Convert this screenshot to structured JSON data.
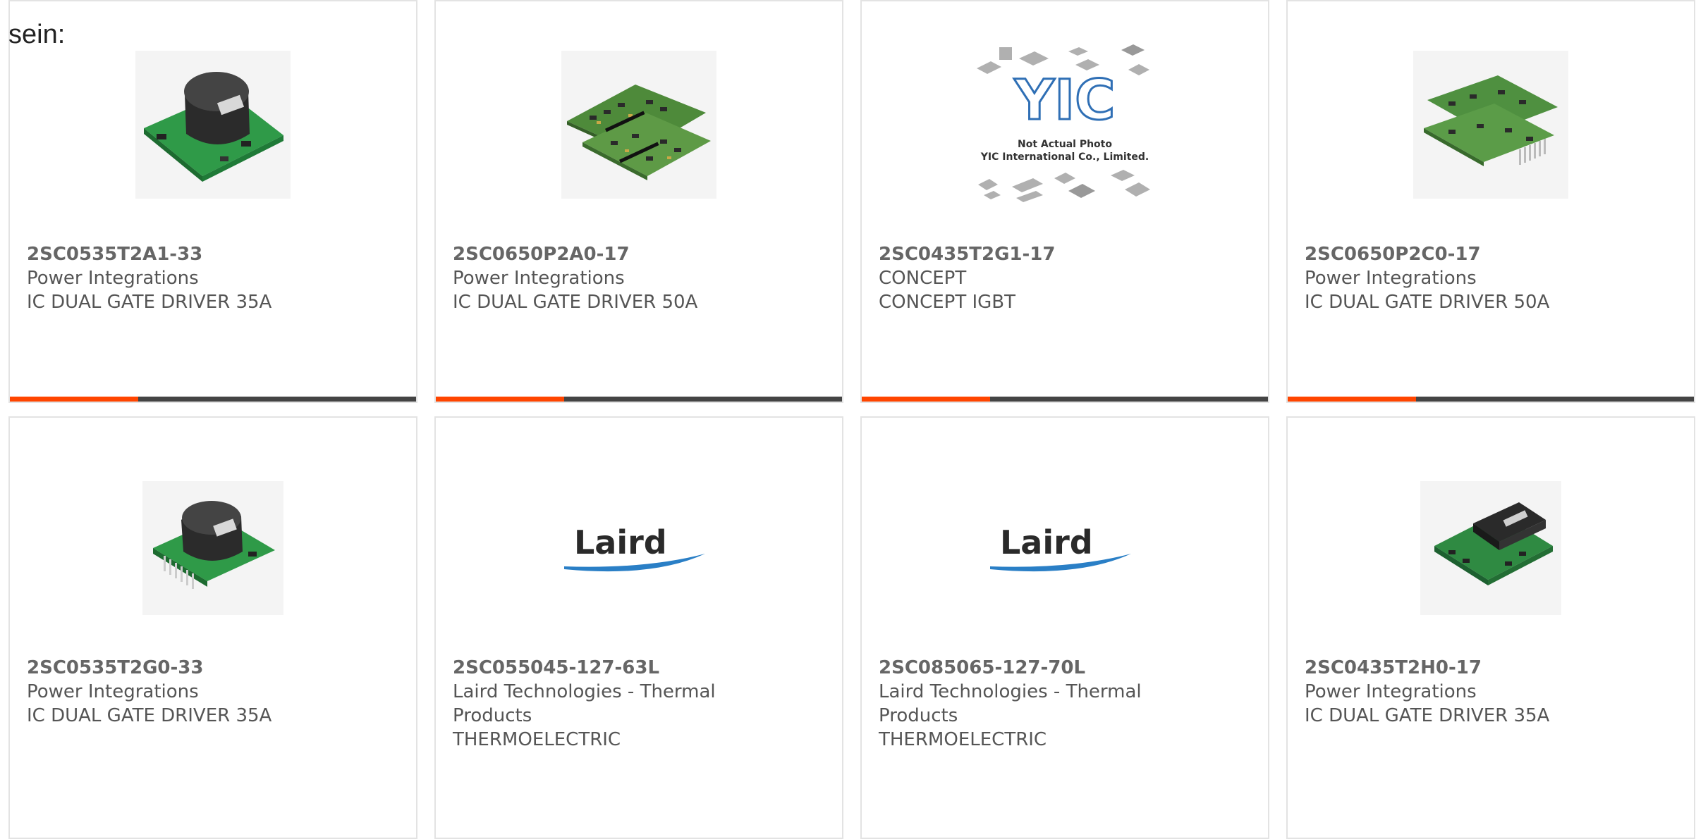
{
  "intro_text": "sein:",
  "brand_accent": "#ff4500",
  "bar_color": "#444444",
  "products": [
    {
      "part_number": "2SC0535T2A1-33",
      "manufacturer": "Power Integrations",
      "description": "IC DUAL GATE DRIVER 35A",
      "image": "driver-board-round-transformer"
    },
    {
      "part_number": "2SC0650P2A0-17",
      "manufacturer": "Power Integrations",
      "description": "IC DUAL GATE DRIVER 50A",
      "image": "dual-driver-board"
    },
    {
      "part_number": "2SC0435T2G1-17",
      "manufacturer": "CONCEPT",
      "description": "CONCEPT IGBT",
      "image": "yic-placeholder",
      "image_text": {
        "logo": "YIC",
        "line1": "Not Actual Photo",
        "line2": "YIC International Co., Limited."
      }
    },
    {
      "part_number": "2SC0650P2C0-17",
      "manufacturer": "Power Integrations",
      "description": "IC DUAL GATE DRIVER 50A",
      "image": "dual-driver-board-pins"
    },
    {
      "part_number": "2SC0535T2G0-33",
      "manufacturer": "Power Integrations",
      "description": "IC DUAL GATE DRIVER 35A",
      "image": "driver-board-round-transformer-pins"
    },
    {
      "part_number": "2SC055045-127-63L",
      "manufacturer_line1": "Laird Technologies - Thermal",
      "manufacturer_line2": "Products",
      "description": "THERMOELECTRIC",
      "image": "laird-logo",
      "logo_text": "Laird"
    },
    {
      "part_number": "2SC085065-127-70L",
      "manufacturer_line1": "Laird Technologies - Thermal",
      "manufacturer_line2": "Products",
      "description": "THERMOELECTRIC",
      "image": "laird-logo",
      "logo_text": "Laird"
    },
    {
      "part_number": "2SC0435T2H0-17",
      "manufacturer": "Power Integrations",
      "description": "IC DUAL GATE DRIVER 35A",
      "image": "compact-driver-board"
    }
  ]
}
